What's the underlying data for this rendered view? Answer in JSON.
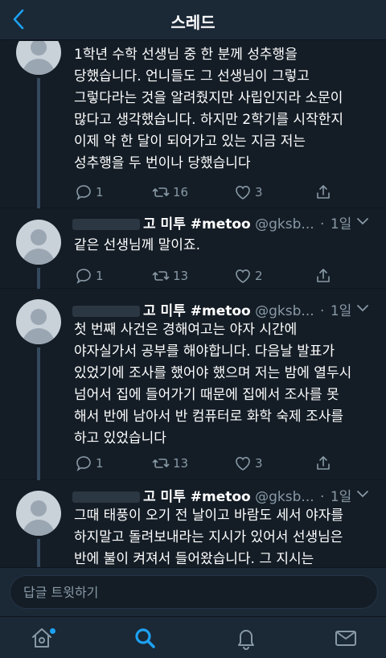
{
  "header": {
    "title": "스레드",
    "back_icon": "chevron-left-icon"
  },
  "tweets": [
    {
      "lines": [
        "1학년 수학 선생님 중 한 분께 성추행을",
        "당했습니다. 언니들도 그 선생님이 그렇고",
        "그렇다라는 것을 알려줬지만 사립인지라 소문이",
        "많다고 생각했습니다. 하지만 2학기를 시작한지",
        "이제 약 한 달이 되어가고 있는 지금 저는",
        "성추행을 두 번이나 당했습니다"
      ],
      "replies": "1",
      "retweets": "16",
      "likes": "3"
    },
    {
      "author": "고 미투 #metoo",
      "handle": "@gksb...",
      "time": "1일",
      "lines": [
        "같은 선생님께 말이죠."
      ],
      "replies": "1",
      "retweets": "13",
      "likes": "2"
    },
    {
      "author": "고 미투 #metoo",
      "handle": "@gksb...",
      "time": "1일",
      "lines": [
        "첫 번째 사건은 경해여고는 야자 시간에",
        "야자실가서 공부를 해야합니다. 다음날 발표가",
        "있었기에 조사를 했어야 했으며 저는 밤에 열두시",
        "넘어서 집에 들어가기 때문에 집에서 조사를 못",
        "해서 반에 남아서 반 컴퓨터로 화학 숙제 조사를",
        "하고 있었습니다"
      ],
      "replies": "1",
      "retweets": "13",
      "likes": "3"
    },
    {
      "author": "고 미투 #metoo",
      "handle": "@gksb...",
      "time": "1일",
      "lines": [
        "그때 태풍이 오기 전 날이고 바람도 세서 야자를",
        "하지말고 돌려보내라는 지시가 있어서 선생님은",
        "반에 불이 켜져서 들어왔습니다. 그 지시는"
      ]
    }
  ],
  "reply_box": {
    "placeholder": "답글 트윗하기"
  },
  "tabbar": {
    "icons": [
      "home-icon",
      "search-icon",
      "notifications-icon",
      "messages-icon"
    ],
    "active": "search-icon",
    "accent": "#1da1f2",
    "inactive_color": "#8899a6"
  },
  "colors": {
    "background": "#141d26",
    "bar": "#1b2836",
    "muted": "#8899a6",
    "accent": "#1da1f2"
  }
}
